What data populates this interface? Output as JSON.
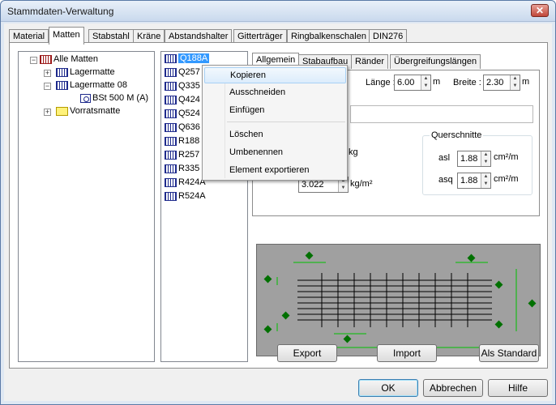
{
  "window": {
    "title": "Stammdaten-Verwaltung"
  },
  "tabs": [
    "Material",
    "Matten",
    "Stabstahl",
    "Kräne",
    "Abstandshalter",
    "Gitterträger",
    "Ringbalkenschalen",
    "DIN276"
  ],
  "tree": {
    "root": "Alle Matten",
    "items": [
      "Lagermatte",
      "Lagermatte 08",
      "BSt 500 M (A)",
      "Vorratsmatte"
    ]
  },
  "list": [
    "Q188A",
    "Q257",
    "Q335",
    "Q424",
    "Q524",
    "Q636",
    "R188",
    "R257",
    "R335",
    "R424A",
    "R524A"
  ],
  "subtabs": [
    "Allgemein",
    "Stabaufbau",
    "Ränder",
    "Übergreifungslängen"
  ],
  "fields": {
    "laenge_label": "Länge :",
    "laenge_value": "6.00",
    "laenge_unit": "m",
    "breite_label": "Breite :",
    "breite_value": "2.30",
    "breite_unit": "m",
    "kg_unit": "kg",
    "gewicht_value": "3.022",
    "gewicht_unit": "kg/m²"
  },
  "querschnitte": {
    "title": "Querschnitte",
    "asl_label": "asl",
    "asl_value": "1.88",
    "asl_unit": "cm²/m",
    "asq_label": "asq",
    "asq_value": "1.88",
    "asq_unit": "cm²/m"
  },
  "context_menu": [
    "Kopieren",
    "Ausschneiden",
    "Einfügen",
    "Löschen",
    "Umbenennen",
    "Element exportieren"
  ],
  "buttons": {
    "export": "Export",
    "import": "Import",
    "standard": "Als Standard",
    "ok": "OK",
    "cancel": "Abbrechen",
    "help": "Hilfe"
  }
}
